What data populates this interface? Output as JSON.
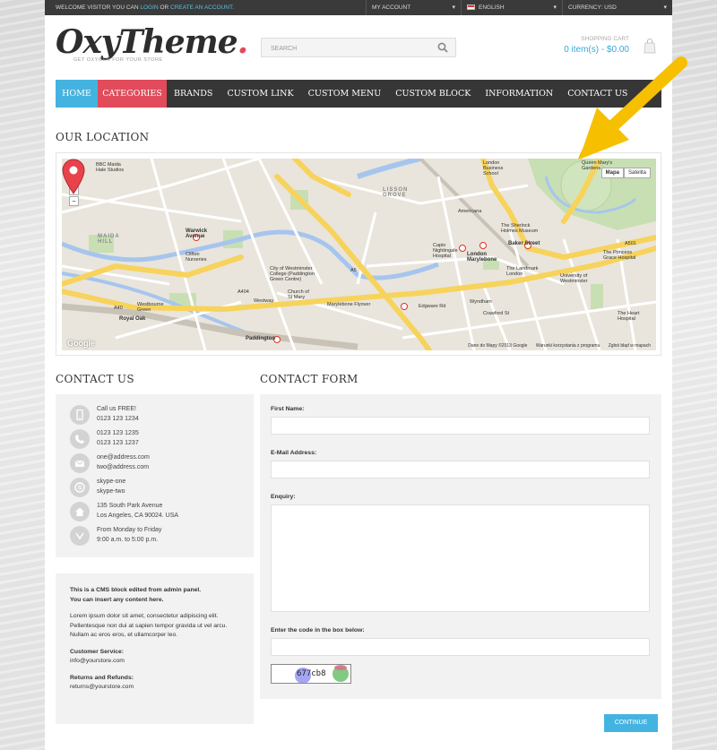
{
  "topbar": {
    "welcome_prefix": "WELCOME VISITOR YOU CAN",
    "login": "LOGIN",
    "or": "OR",
    "create_account": "CREATE AN ACCOUNT.",
    "my_account": "MY ACCOUNT",
    "language": "ENGLISH",
    "currency": "CURRENCY: USD"
  },
  "header": {
    "logo_main": "OxyTheme",
    "logo_dot": ".",
    "logo_tagline": "GET OXYGEN FOR YOUR STORE",
    "search_placeholder": "SEARCH",
    "cart_label": "SHOPPING CART",
    "cart_value": "0 item(s) - $0.00"
  },
  "nav": [
    "HOME",
    "CATEGORIES",
    "BRANDS",
    "CUSTOM LINK",
    "CUSTOM MENU",
    "CUSTOM BLOCK",
    "INFORMATION",
    "CONTACT US"
  ],
  "location": {
    "title": "OUR LOCATION",
    "map_type": [
      "Mapa",
      "Satelita"
    ],
    "zoom_in": "+",
    "zoom_out": "−",
    "footer": [
      "Dane do Mapy ©2013 Google",
      "Warunki korzystania z programu",
      "Zgłoś błąd w mapach"
    ],
    "google": "Google",
    "labels": {
      "bbc": "BBC Maida\nHale Studios",
      "warwick_avenue": "Warwick\nAvenue",
      "maida_hill": "MAIDA\nHILL",
      "lisson_grove": "LISSON\nGROVE",
      "marylebone": "London\nMarylebone",
      "baker_street": "Baker Street",
      "edgware_road": "Edgware Rd",
      "westway": "Westway",
      "marylebone_flyover": "Marylebone Flyover",
      "royal_oak": "Royal Oak",
      "paddington": "Paddington",
      "queen_mary": "Queen Mary's\nGardens",
      "london_business": "London\nBusiness\nSchool",
      "sherlock": "The Sherlock\nHolmes Museum",
      "landmark": "The Landmark\nLondon",
      "princess_grace": "The Princess\nGrace Hospital",
      "westminster_uni": "University of\nWestminster",
      "heart_hospital": "The Heart\nHospital",
      "wyndham": "Wyndham",
      "crawford": "Crawford St",
      "westbourne": "Westbourne\nGreen",
      "clifton": "Clifton\nNurseries",
      "church": "Church of\nSt Mary",
      "city_westminster": "City of Westminster\nCollege (Paddington\nGreen Centre)",
      "capio": "Capio\nNightingale\nHospital",
      "americana": "Americana",
      "a5": "A5",
      "a40": "A40",
      "a501": "A501",
      "a404": "A404"
    }
  },
  "contact_us": {
    "title": "CONTACT US",
    "rows": [
      {
        "line1": "Call us FREE!",
        "line2": "0123 123 1234"
      },
      {
        "line1": "0123 123 1235",
        "line2": "0123 123 1237"
      },
      {
        "line1": "one@address.com",
        "line2": "two@address.com"
      },
      {
        "line1": "skype-one",
        "line2": "skype-two"
      },
      {
        "line1": "135 South Park Avenue",
        "line2": "Los Angeles, CA 90024. USA"
      },
      {
        "line1": "From Monday to Friday",
        "line2": "9:00 a.m. to 5:00 p.m."
      }
    ]
  },
  "cms": {
    "bold1": "This is a CMS block edited from admin panel.",
    "bold2": "You can insert any content here.",
    "lorem": "Lorem ipsum dolor sit amet, consectetur adipiscing elit. Pellentesque non dui at sapien tempor gravida ut vel arcu. Nullam ac eros eros, et ullamcorper leo.",
    "service_label": "Customer Service:",
    "service_email": "info@yourstore.com",
    "returns_label": "Returns and Refunds:",
    "returns_email": "returns@yourstore.com"
  },
  "form": {
    "title": "CONTACT FORM",
    "first_name": "First Name:",
    "email": "E-Mail Address:",
    "enquiry": "Enquiry:",
    "captcha_label": "Enter the code in the box below:",
    "captcha_code": "677cb8",
    "continue": "CONTINUE"
  },
  "colors": {
    "accent_blue": "#45b3e0",
    "accent_red": "#e24b5b",
    "nav_bg": "#363636",
    "topbar_bg": "#3a3a3a",
    "arrow": "#f6c000"
  }
}
